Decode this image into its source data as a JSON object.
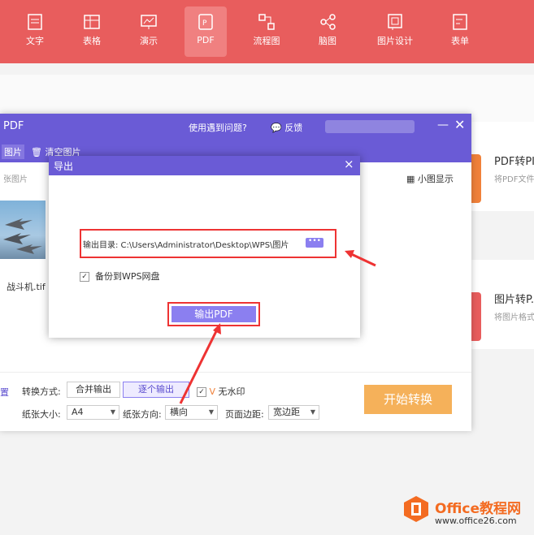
{
  "nav": {
    "items": [
      {
        "label": "文字",
        "icon": "doc-icon"
      },
      {
        "label": "表格",
        "icon": "table-icon"
      },
      {
        "label": "演示",
        "icon": "presentation-icon"
      },
      {
        "label": "PDF",
        "icon": "pdf-icon",
        "active": true
      },
      {
        "label": "流程图",
        "icon": "flowchart-icon"
      },
      {
        "label": "脑图",
        "icon": "mindmap-icon"
      },
      {
        "label": "图片设计",
        "icon": "image-design-icon"
      },
      {
        "label": "表单",
        "icon": "form-icon"
      }
    ]
  },
  "right_cards": [
    {
      "title": "PDF转PI",
      "desc": "将PDF文件"
    },
    {
      "title": "图片转P.",
      "desc": "将图片格式"
    }
  ],
  "window": {
    "title": "PDF",
    "help": "使用遇到问题?",
    "feedback": "反馈",
    "tab_images": "图片",
    "clear_images": "清空图片",
    "count_label": "张图片",
    "small_view": "小图显示",
    "thumb_name": "战斗机.tif"
  },
  "options": {
    "convert_mode_label": "转换方式:",
    "merge_output": "合并输出",
    "individual_output": "逐个输出",
    "no_watermark": "无水印",
    "paper_size_label": "纸张大小:",
    "paper_size": "A4",
    "orientation_label": "纸张方向:",
    "orientation": "横向",
    "margin_label": "页面边距:",
    "margin": "宽边距",
    "settings_fragment": "置",
    "start_button": "开始转换"
  },
  "dialog": {
    "title": "导出",
    "output_dir": "输出目录:  C:\\Users\\Administrator\\Desktop\\WPS\\图片",
    "more": "•••",
    "backup": "备份到WPS网盘",
    "export_button": "输出PDF"
  },
  "logo": {
    "brand": "Office教程网",
    "url": "www.office26.com"
  },
  "colors": {
    "topbar": "#e85d5d",
    "purple": "#6a5bd6",
    "accent": "#8b7ff0",
    "start": "#f5b15a",
    "highlight": "#ee3333"
  }
}
